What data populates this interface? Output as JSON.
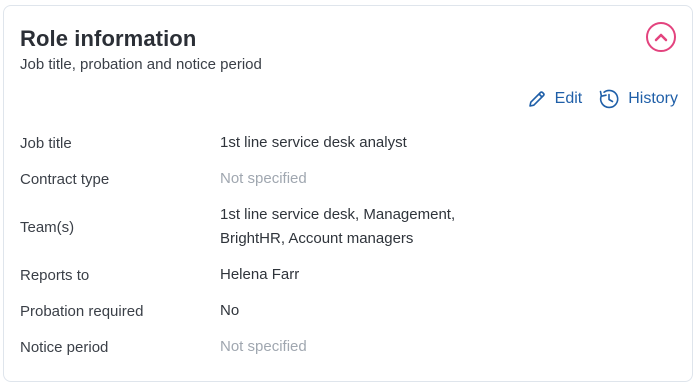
{
  "card": {
    "title": "Role information",
    "subtitle": "Job title, probation and notice period",
    "collapse_icon": "chevron-up-icon",
    "accent_color": "#e3437e",
    "link_color": "#1f5fa8"
  },
  "actions": {
    "edit_label": "Edit",
    "edit_icon": "pencil-icon",
    "history_label": "History",
    "history_icon": "history-clock-icon"
  },
  "fields": {
    "job_title": {
      "label": "Job title",
      "value": "1st line service desk analyst"
    },
    "contract_type": {
      "label": "Contract type",
      "value": "Not specified"
    },
    "teams": {
      "label": "Team(s)",
      "value_line1": "1st line service desk, Management,",
      "value_line2": "BrightHR, Account managers"
    },
    "reports_to": {
      "label": "Reports to",
      "value": "Helena Farr"
    },
    "probation": {
      "label": "Probation required",
      "value": "No"
    },
    "notice_period": {
      "label": "Notice period",
      "value": "Not specified"
    }
  }
}
